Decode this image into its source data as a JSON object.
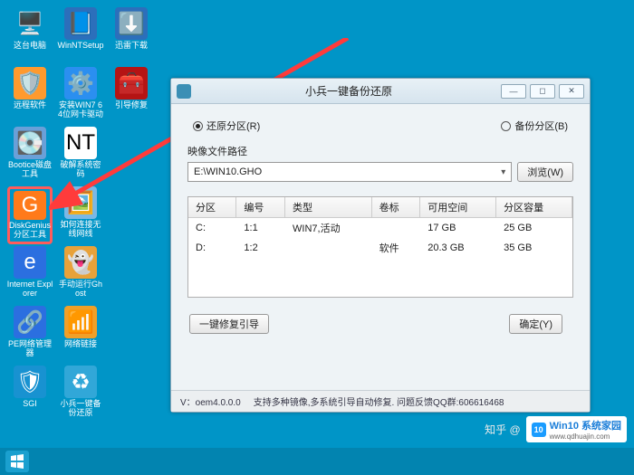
{
  "desktop_icons": [
    {
      "name": "icon-this-pc",
      "label": "这台电脑",
      "glyph": "🖥️",
      "bg": "transparent"
    },
    {
      "name": "icon-winntsetup",
      "label": "WinNTSetup",
      "glyph": "📘",
      "bg": "#2c6fbb"
    },
    {
      "name": "icon-thunder",
      "label": "迅雷下载",
      "glyph": "⬇️",
      "bg": "#2c6fbb"
    },
    {
      "name": "icon-remote",
      "label": "远程软件",
      "glyph": "🛡️",
      "bg": "#ff9a2e"
    },
    {
      "name": "icon-win7drv",
      "label": "安装WIN7 64位网卡驱动",
      "glyph": "⚙️",
      "bg": "#2b8ff0"
    },
    {
      "name": "icon-bootfix",
      "label": "引导修复",
      "glyph": "🧰",
      "bg": "#b51414"
    },
    {
      "name": "icon-bootice",
      "label": "Bootice磁盘工具",
      "glyph": "💽",
      "bg": "#6aa0d8"
    },
    {
      "name": "icon-crack",
      "label": "破解系统密码",
      "glyph": "NT",
      "bg": "#fff"
    },
    {
      "name": "empty1",
      "label": "",
      "glyph": "",
      "bg": "transparent"
    },
    {
      "name": "icon-diskgenius",
      "label": "DiskGenius分区工具",
      "glyph": "G",
      "bg": "#ff7a1a",
      "hl": true
    },
    {
      "name": "icon-wifi",
      "label": "如何连接无线网线",
      "glyph": "🖼️",
      "bg": "#7ab8e6"
    },
    {
      "name": "empty2",
      "label": "",
      "glyph": "",
      "bg": "transparent"
    },
    {
      "name": "icon-ie",
      "label": "Internet Explorer",
      "glyph": "e",
      "bg": "#2b6fe0"
    },
    {
      "name": "icon-ghost",
      "label": "手动运行Ghost",
      "glyph": "👻",
      "bg": "#e8a23a"
    },
    {
      "name": "empty3",
      "label": "",
      "glyph": "",
      "bg": "transparent"
    },
    {
      "name": "icon-penet",
      "label": "PE网络管理器",
      "glyph": "🔗",
      "bg": "#2b6fe0"
    },
    {
      "name": "icon-netlink",
      "label": "网络链接",
      "glyph": "📶",
      "bg": "#f0a028"
    },
    {
      "name": "empty4",
      "label": "",
      "glyph": "",
      "bg": "transparent"
    },
    {
      "name": "icon-sgi",
      "label": "SGI",
      "glyph": "🛡",
      "bg": "#1892d1"
    },
    {
      "name": "icon-xiaobing",
      "label": "小兵一键备份还原",
      "glyph": "♻",
      "bg": "#31a7d8"
    }
  ],
  "window": {
    "title": "小兵一键备份还原",
    "radio_restore": "还原分区(R)",
    "radio_backup": "备份分区(B)",
    "path_label": "映像文件路径",
    "path_value": "E:\\WIN10.GHO",
    "browse": "浏览(W)",
    "columns": [
      "分区",
      "编号",
      "类型",
      "卷标",
      "可用空间",
      "分区容量"
    ],
    "rows": [
      {
        "part": "C:",
        "idx": "1:1",
        "type": "WIN7,活动",
        "label": "",
        "free": "17 GB",
        "cap": "25 GB"
      },
      {
        "part": "D:",
        "idx": "1:2",
        "type": "",
        "label": "软件",
        "free": "20.3 GB",
        "cap": "35 GB"
      }
    ],
    "boot_fix": "一键修复引导",
    "ok": "确定(Y)",
    "status_ver": "V：oem4.0.0.0",
    "status_msg": "支持多种镜像,多系统引导自动修复. 问题反馈QQ群:606616468"
  },
  "watermark": {
    "zhihu": "知乎 @",
    "win10_t1": "Win10 系统家园",
    "win10_t2": "www.qdhuajin.com",
    "badge": "10"
  }
}
